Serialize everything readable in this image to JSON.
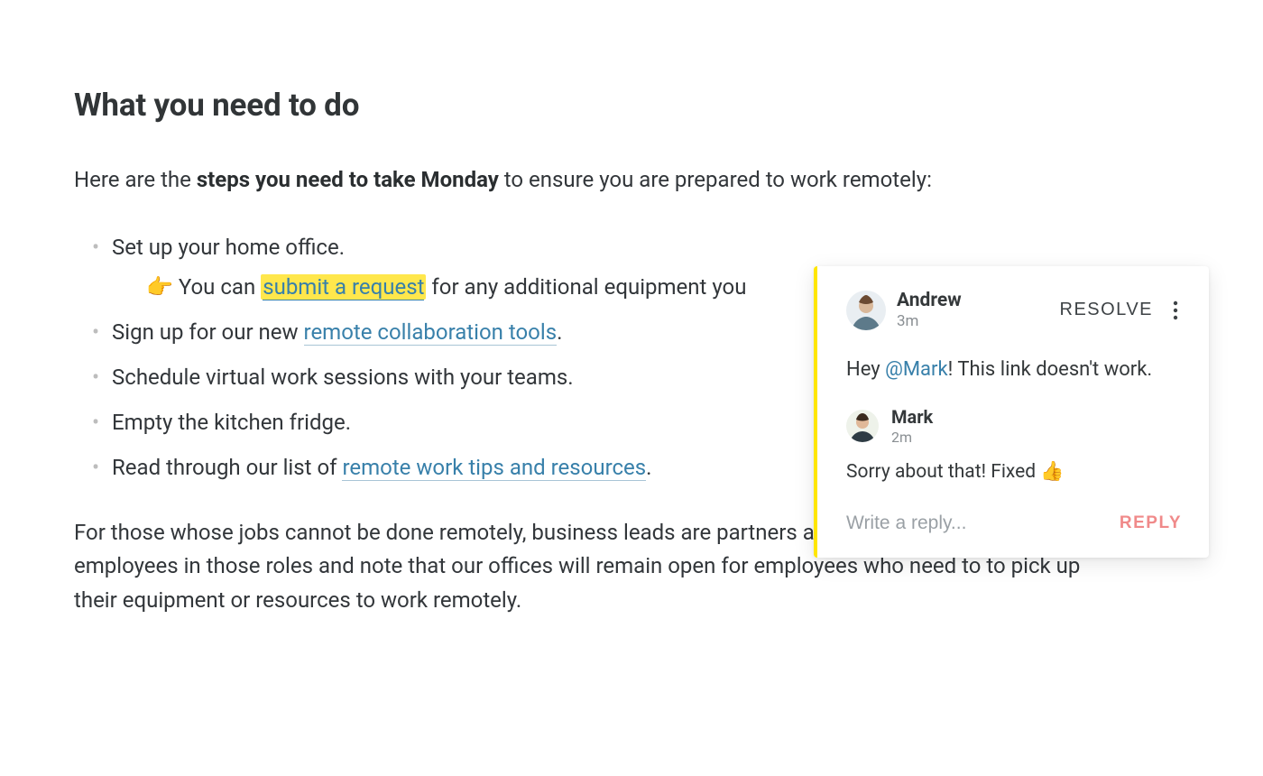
{
  "heading": "What you need to do",
  "intro_parts": {
    "before": "Here are the ",
    "bold": "steps you need to take Monday",
    "after": " to ensure you are prepared to work remotely:"
  },
  "bullets": [
    {
      "text": "Set up your home office.",
      "sub": {
        "emoji": "👉",
        "pre": " You can ",
        "link_text": "submit a request",
        "post": " for any additional equipment you"
      }
    },
    {
      "pre": "Sign up for our new ",
      "link_text": "remote collaboration tools",
      "post": "."
    },
    {
      "text": "Schedule virtual work sessions with your teams."
    },
    {
      "text": "Empty the kitchen fridge."
    },
    {
      "pre": "Read through our list of ",
      "link_text": "remote work tips and resources",
      "post": "."
    }
  ],
  "paragraph": "For those whose jobs cannot be done remotely, business leads are partners and managers to support employees in those roles and note that our offices will remain open for employees who need to to pick up their equipment or resources to work remotely.",
  "comment_panel": {
    "resolve_label": "RESOLVE",
    "comments": [
      {
        "author": "Andrew",
        "time": "3m",
        "body_pre": "Hey ",
        "mention": "@Mark",
        "body_post": "! This link doesn't work."
      },
      {
        "author": "Mark",
        "time": "2m",
        "body": "Sorry about that! Fixed ",
        "emoji": "👍"
      }
    ],
    "reply_placeholder": "Write a reply...",
    "reply_button": "REPLY"
  }
}
